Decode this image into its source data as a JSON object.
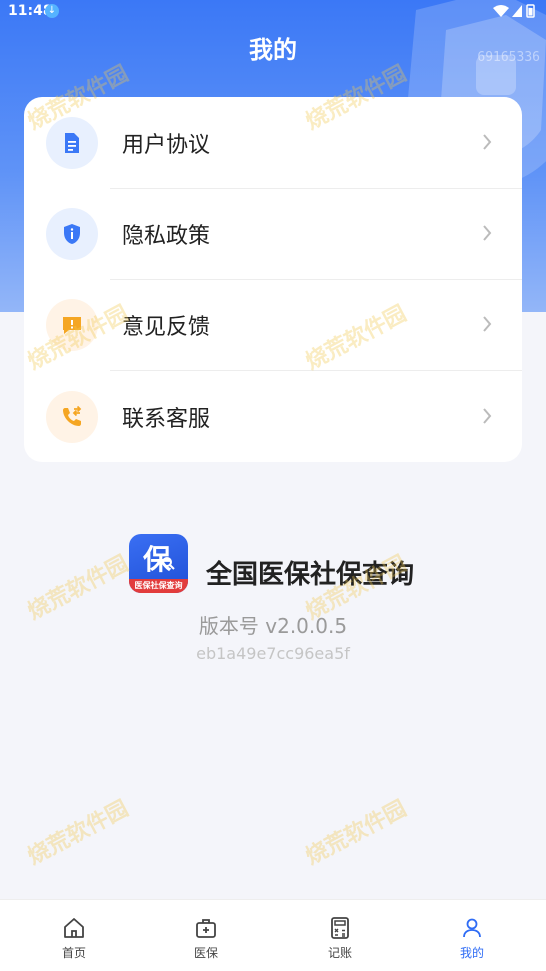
{
  "status_bar": {
    "time": "11:48",
    "download_icon": "download-arrow-icon",
    "icons": [
      "wifi-icon",
      "signal-icon",
      "battery-icon"
    ]
  },
  "header": {
    "title": "我的",
    "corner_id": "69165336"
  },
  "menu": {
    "items": [
      {
        "label": "用户协议",
        "icon": "document-icon",
        "icon_color": "#3b78f6",
        "icon_bg": "#e8f0fe"
      },
      {
        "label": "隐私政策",
        "icon": "shield-info-icon",
        "icon_color": "#3b78f6",
        "icon_bg": "#e8f0fe"
      },
      {
        "label": "意见反馈",
        "icon": "feedback-icon",
        "icon_color": "#f5a623",
        "icon_bg": "#fff3e6"
      },
      {
        "label": "联系客服",
        "icon": "phone-transfer-icon",
        "icon_color": "#f5a623",
        "icon_bg": "#fff3e6"
      }
    ]
  },
  "app_info": {
    "logo_char": "保",
    "logo_strip": "医保社保查询",
    "name": "全国医保社保查询",
    "version": "版本号 v2.0.0.5",
    "hash": "eb1a49e7cc96ea5f"
  },
  "watermark": "烧荒软件园",
  "tab_bar": {
    "tabs": [
      {
        "label": "首页",
        "icon": "home-icon",
        "active": false
      },
      {
        "label": "医保",
        "icon": "medical-kit-icon",
        "active": false
      },
      {
        "label": "记账",
        "icon": "calculator-icon",
        "active": false
      },
      {
        "label": "我的",
        "icon": "user-icon",
        "active": true
      }
    ],
    "active_color": "#2f6cf5"
  }
}
